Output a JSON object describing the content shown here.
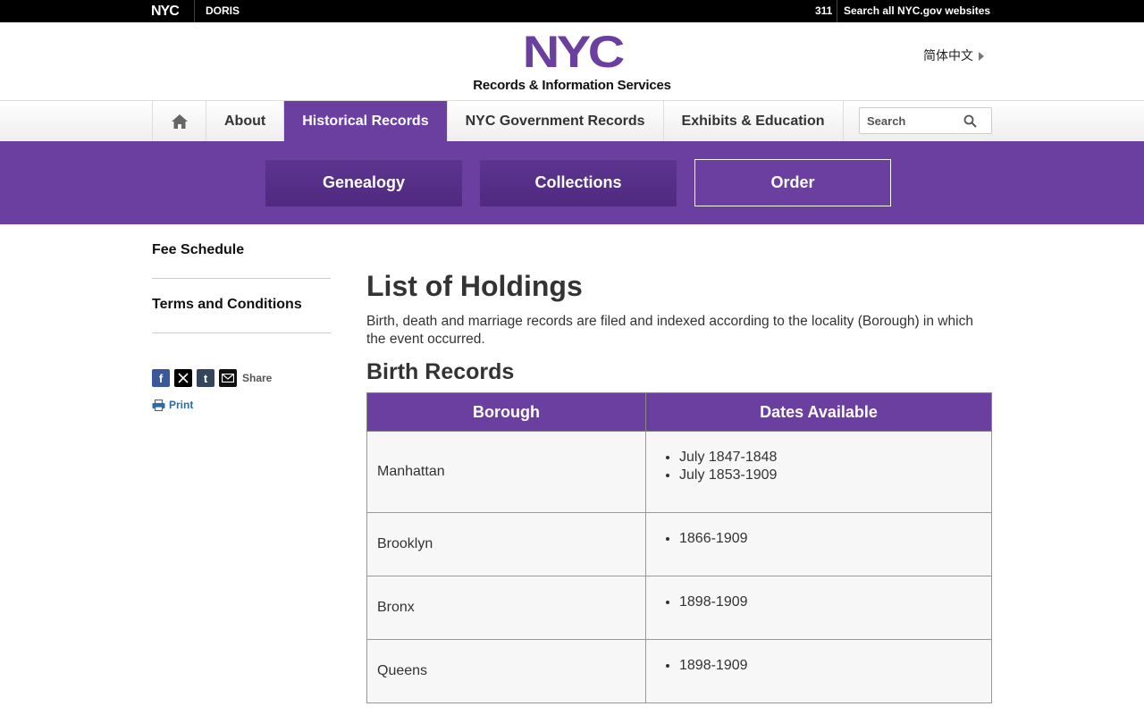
{
  "topbar": {
    "logo": "NYC",
    "agency": "DORIS",
    "link_311": "311",
    "search_all": "Search all NYC.gov websites"
  },
  "header": {
    "logo_text": "NYC",
    "logo_sub": "Records & Information Services",
    "language": "简体中文"
  },
  "nav": {
    "items": [
      {
        "label": "About"
      },
      {
        "label": "Historical Records",
        "active": true
      },
      {
        "label": "NYC Government Records"
      },
      {
        "label": "Exhibits & Education"
      }
    ],
    "search_placeholder": "Search"
  },
  "subnav": {
    "genealogy": "Genealogy",
    "collections": "Collections",
    "order": "Order"
  },
  "sidebar": {
    "links": [
      "Fee Schedule",
      "Terms and Conditions"
    ],
    "share_label": "Share",
    "print_label": "Print"
  },
  "content": {
    "title": "List of Holdings",
    "intro": "Birth, death and marriage records are filed and indexed according to the locality (Borough) in which the event occurred.",
    "section": "Birth Records",
    "table": {
      "headers": [
        "Borough",
        "Dates Available"
      ],
      "rows": [
        {
          "borough": "Manhattan",
          "dates": [
            "July 1847-1848",
            "July 1853-1909"
          ]
        },
        {
          "borough": "Brooklyn",
          "dates": [
            "1866-1909"
          ]
        },
        {
          "borough": "Bronx",
          "dates": [
            "1898-1909"
          ]
        },
        {
          "borough": "Queens",
          "dates": [
            "1898-1909"
          ]
        }
      ]
    }
  },
  "colors": {
    "brand_purple": "#6b3fa0",
    "link_blue": "#2b6ca3"
  }
}
